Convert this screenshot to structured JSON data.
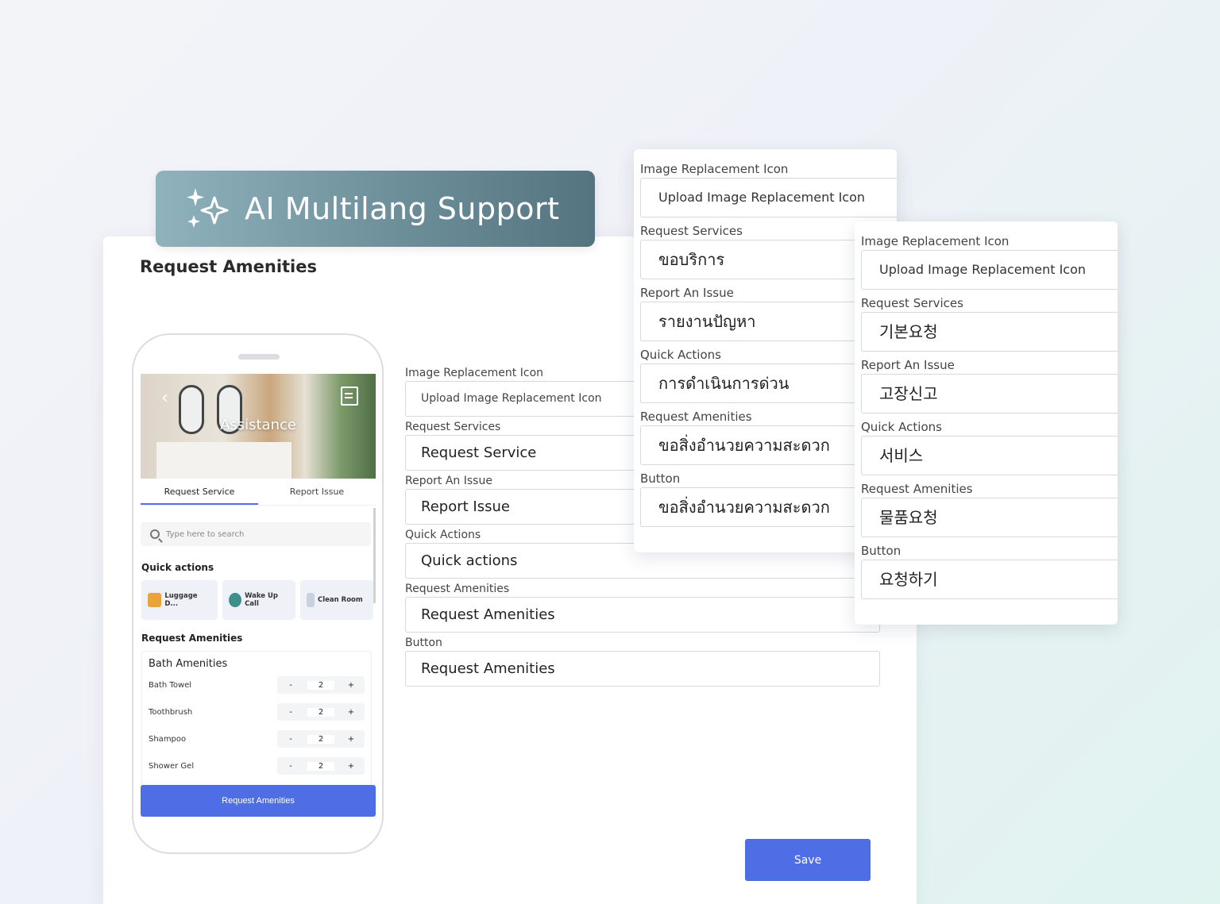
{
  "banner": {
    "title": "AI Multilang Support",
    "icon": "sparkle-icon"
  },
  "page": {
    "title": "Request Amenities"
  },
  "phone": {
    "hero_title": "Assistance",
    "tabs": [
      "Request Service",
      "Report Issue"
    ],
    "search_placeholder": "Type here to search",
    "quick_actions_title": "Quick actions",
    "quick_actions": [
      "Luggage D...",
      "Wake Up Call",
      "Clean Room"
    ],
    "amenities_title": "Request Amenities",
    "amenities_group": "Bath Amenities",
    "amenities": [
      {
        "name": "Bath Towel",
        "qty": "2"
      },
      {
        "name": "Toothbrush",
        "qty": "2"
      },
      {
        "name": "Shampoo",
        "qty": "2"
      },
      {
        "name": "Shower Gel",
        "qty": "2"
      }
    ],
    "stepper_minus": "-",
    "stepper_plus": "+",
    "button": "Request Amenities"
  },
  "form": {
    "fields": [
      {
        "label": "Image Replacement Icon",
        "value": "Upload Image Replacement Icon"
      },
      {
        "label": "Request Services",
        "value": "Request Service"
      },
      {
        "label": "Report An Issue",
        "value": "Report Issue"
      },
      {
        "label": "Quick Actions",
        "value": "Quick actions"
      },
      {
        "label": "Request Amenities",
        "value": "Request Amenities"
      },
      {
        "label": "Button",
        "value": "Request Amenities"
      }
    ],
    "save": "Save"
  },
  "thai_card": {
    "fields": [
      {
        "label": "Image Replacement Icon",
        "value": "Upload Image Replacement Icon"
      },
      {
        "label": "Request Services",
        "value": "ขอบริการ"
      },
      {
        "label": "Report An Issue",
        "value": "รายงานปัญหา"
      },
      {
        "label": "Quick Actions",
        "value": "การดำเนินการด่วน"
      },
      {
        "label": "Request Amenities",
        "value": "ขอสิ่งอำนวยความสะดวก"
      },
      {
        "label": "Button",
        "value": "ขอสิ่งอำนวยความสะดวก"
      }
    ]
  },
  "korean_card": {
    "fields": [
      {
        "label": "Image Replacement Icon",
        "value": "Upload Image Replacement Icon"
      },
      {
        "label": "Request Services",
        "value": "기본요청"
      },
      {
        "label": "Report An Issue",
        "value": "고장신고"
      },
      {
        "label": "Quick Actions",
        "value": "서비스"
      },
      {
        "label": "Request Amenities",
        "value": "물품요청"
      },
      {
        "label": "Button",
        "value": "요청하기"
      }
    ]
  },
  "colors": {
    "primary": "#4f6ee6",
    "banner_start": "#8fb2bd",
    "banner_end": "#547480"
  }
}
